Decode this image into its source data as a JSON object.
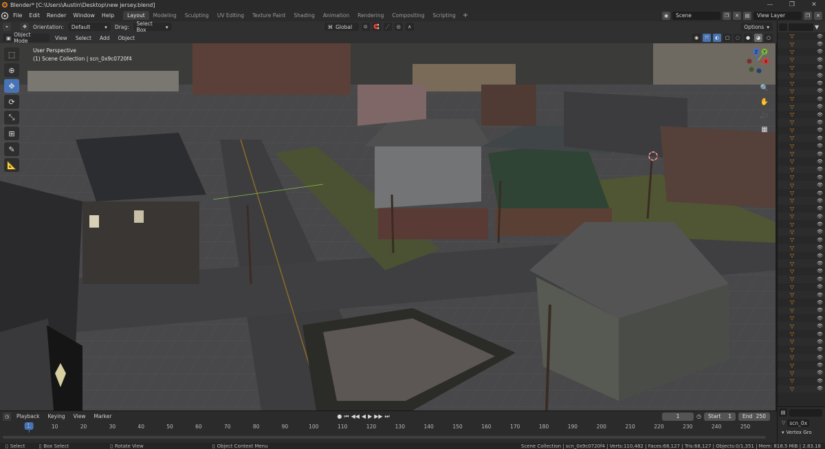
{
  "window": {
    "title": "Blender* [C:\\Users\\Austin\\Desktop\\new jersey.blend]",
    "controls": [
      "—",
      "❐",
      "✕"
    ]
  },
  "menu": [
    "File",
    "Edit",
    "Render",
    "Window",
    "Help"
  ],
  "workspaces": [
    "Layout",
    "Modeling",
    "Sculpting",
    "UV Editing",
    "Texture Paint",
    "Shading",
    "Animation",
    "Rendering",
    "Compositing",
    "Scripting"
  ],
  "active_workspace": "Layout",
  "scene_field": "Scene",
  "view_layer_field": "View Layer",
  "tool_header": {
    "orientation_label": "Orientation:",
    "orientation_value": "Default",
    "drag_label": "Drag:",
    "drag_value": "Select Box",
    "transform_orientation": "Global",
    "options": "Options"
  },
  "view_header": {
    "mode": "Object Mode",
    "items": [
      "View",
      "Select",
      "Add",
      "Object"
    ]
  },
  "viewport": {
    "perspective": "User Perspective",
    "collection": "(1) Scene Collection | scn_0x9c0720f4"
  },
  "gizmo": {
    "x": "X",
    "y": "Y",
    "z": "Z"
  },
  "outliner": {
    "rows": 46,
    "object_name": "scn_0x",
    "vertex_groups": "Vertex Gro"
  },
  "timeline": {
    "menus": [
      "Playback",
      "Keying",
      "View",
      "Marker"
    ],
    "current_frame": "1",
    "start_label": "Start",
    "start": "1",
    "end_label": "End",
    "end": "250",
    "ruler": [
      "1",
      "10",
      "20",
      "30",
      "40",
      "50",
      "60",
      "70",
      "80",
      "90",
      "100",
      "110",
      "120",
      "130",
      "140",
      "150",
      "160",
      "170",
      "180",
      "190",
      "200",
      "210",
      "220",
      "230",
      "240",
      "250"
    ]
  },
  "status": {
    "select": "Select",
    "box_select": "Box Select",
    "rotate_view": "Rotate View",
    "context_menu": "Object Context Menu",
    "stats": "Scene Collection | scn_0x9c0720f4 | Verts:110,482 | Faces:68,127 | Tris:68,127 | Objects:0/1,351 | Mem: 818.5 MiB | 2.83.18"
  },
  "colors": {
    "accent": "#4772b3",
    "object_triangle": "#e58a2a",
    "ground": "#4a4a46"
  }
}
